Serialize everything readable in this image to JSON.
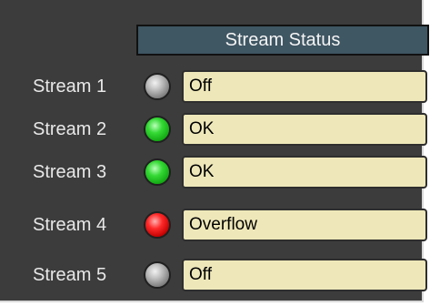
{
  "header": {
    "title": "Stream Status"
  },
  "colors": {
    "panel_bg": "#3c3c3c",
    "header_bg": "#3f5663",
    "field_bg": "#eee7b9",
    "led_off": "#9a9a9a",
    "led_ok": "#27c427",
    "led_error": "#d60000"
  },
  "streams": [
    {
      "label": "Stream 1",
      "status": "Off",
      "indicator": "gray"
    },
    {
      "label": "Stream 2",
      "status": "OK",
      "indicator": "green"
    },
    {
      "label": "Stream 3",
      "status": "OK",
      "indicator": "green"
    },
    {
      "label": "Stream 4",
      "status": "Overflow",
      "indicator": "red"
    },
    {
      "label": "Stream 5",
      "status": "Off",
      "indicator": "gray"
    }
  ]
}
